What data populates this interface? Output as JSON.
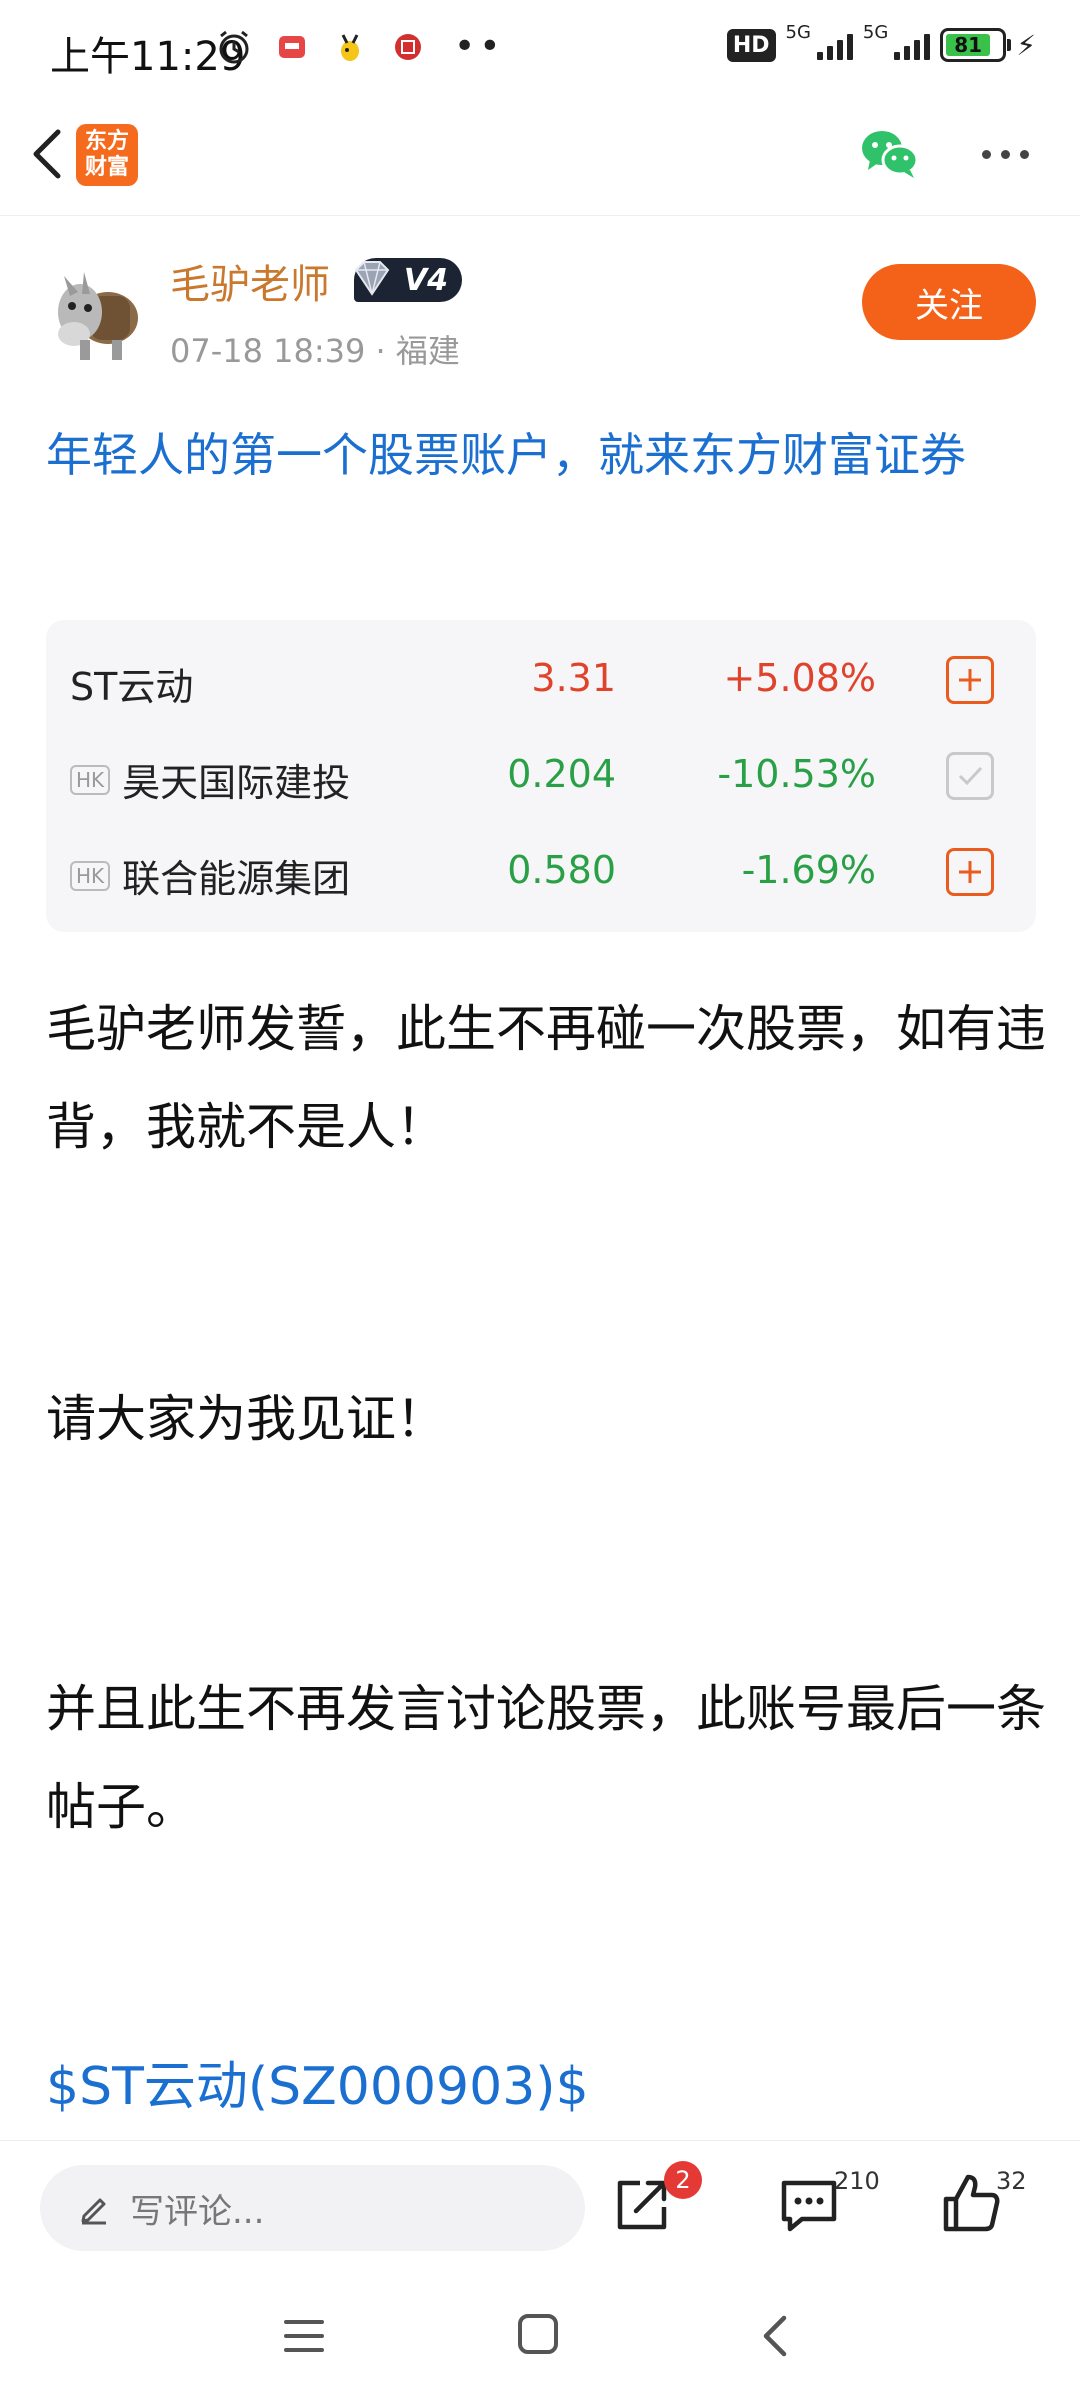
{
  "status_bar": {
    "time": "上午11:29",
    "network": "5G",
    "network2": "5G",
    "hd": "HD",
    "battery": "81",
    "left_icons": [
      "alarm-icon",
      "app-notification-icon",
      "pet-icon",
      "bank-icon"
    ]
  },
  "nav": {
    "app_logo_line1": "东方",
    "app_logo_line2": "财富"
  },
  "author": {
    "name": "毛驴老师",
    "badge": "V4",
    "meta": "07-18 18:39 · 福建",
    "follow_label": "关注"
  },
  "post": {
    "title": "年轻人的第一个股票账户，就来东方财富证券",
    "paragraph1": "毛驴老师发誓，此生不再碰一次股票，如有违背，我就不是人！",
    "paragraph2": "请大家为我见证！",
    "paragraph3": "并且此生不再发言讨论股票，此账号最后一条帖子。",
    "stock_link": "$ST云动(SZ000903)$"
  },
  "stocks": [
    {
      "tag": "",
      "name": "ST云动",
      "price": "3.31",
      "change": "+5.08%",
      "trend": "up",
      "action": "add"
    },
    {
      "tag": "HK",
      "name": "昊天国际建投",
      "price": "0.204",
      "change": "-10.53%",
      "trend": "down",
      "action": "added"
    },
    {
      "tag": "HK",
      "name": "联合能源集团",
      "price": "0.580",
      "change": "-1.69%",
      "trend": "down",
      "action": "add"
    }
  ],
  "bottom_bar": {
    "comment_placeholder": "写评论...",
    "share_badge": "2",
    "comment_count": "210",
    "like_count": "32"
  },
  "colors": {
    "accent_orange": "#f4621a",
    "link_blue": "#1a6fd0",
    "up_red": "#e0432c",
    "down_green": "#2aa046"
  }
}
